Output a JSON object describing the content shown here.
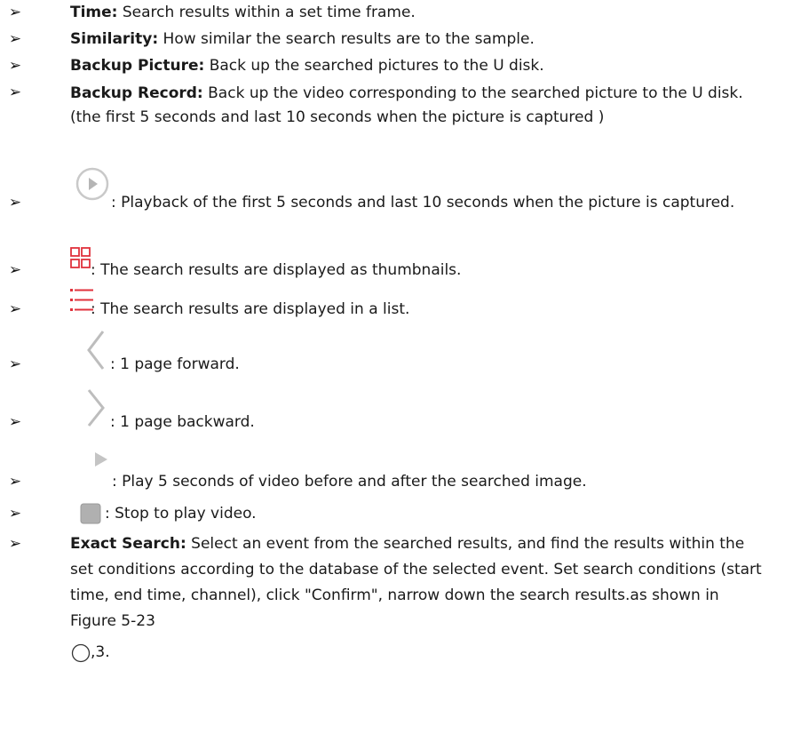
{
  "bullet_glyph": "➢",
  "items": [
    {
      "id": "time",
      "label": "Time:",
      "text": " Search results within a set time frame."
    },
    {
      "id": "similarity",
      "label": "Similarity:",
      "text": " How similar the search results are to the sample."
    },
    {
      "id": "backup-picture",
      "label": "Backup Picture:",
      "text": " Back up the searched pictures to the U disk."
    },
    {
      "id": "backup-record",
      "label": "Backup Record:",
      "text": " Back up the video corresponding to the searched picture to the U disk. (the first 5 seconds and last 10 seconds when the picture is captured )"
    },
    {
      "id": "playback-circle",
      "icon": "play-circle-icon",
      "text": ": Playback of the first 5 seconds and last 10 seconds when the picture is captured."
    },
    {
      "id": "thumbnails",
      "icon": "grid-view-icon",
      "text": ": The search results are displayed as thumbnails."
    },
    {
      "id": "list",
      "icon": "list-view-icon",
      "text": ": The search results are displayed in a list."
    },
    {
      "id": "page-forward",
      "icon": "chevron-left-icon",
      "text": ": 1 page forward."
    },
    {
      "id": "page-backward",
      "icon": "chevron-right-icon",
      "text": ": 1 page backward."
    },
    {
      "id": "play",
      "icon": "play-icon",
      "text": ": Play 5 seconds of video before and after the searched image."
    },
    {
      "id": "stop",
      "icon": "stop-icon",
      "text": ": Stop to play video."
    },
    {
      "id": "exact-search",
      "label": "Exact Search:",
      "text": " Select an event from the searched results, and find the results within the set conditions according to the database of the selected event. Set search conditions (start time, end time, channel), click \"Confirm\", narrow down the search results.as shown in Figure 5-23"
    }
  ],
  "trailing": {
    "icon": "circle-icon",
    "text": ",3."
  },
  "colors": {
    "accent_red": "#e0323c",
    "icon_gray": "#b8b8b8",
    "text": "#1a1a1a"
  }
}
